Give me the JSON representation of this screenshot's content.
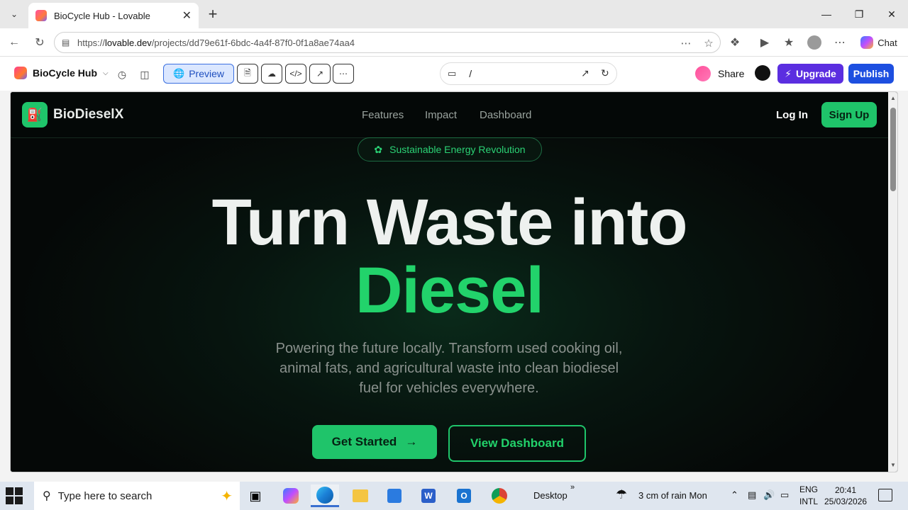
{
  "browser": {
    "tab_title": "BioCycle Hub - Lovable",
    "url_host": "lovable.dev",
    "url_prefix": "https://",
    "url_path": "/projects/dd79e61f-6bdc-4a4f-87f0-0f1a8ae74aa4",
    "chat_label": "Chat"
  },
  "lovable": {
    "project_name": "BioCycle Hub",
    "preview_label": "Preview",
    "route_path": "/",
    "share_label": "Share",
    "upgrade_label": "Upgrade",
    "publish_label": "Publish",
    "colors": {
      "upgrade": "#5b2ee0",
      "publish": "#1d4fe0",
      "preview_bg": "#dbe7ff"
    }
  },
  "site": {
    "brand": "BioDieselX",
    "nav": [
      "Features",
      "Impact",
      "Dashboard"
    ],
    "login_label": "Log In",
    "signup_label": "Sign Up",
    "pill": "Sustainable Energy Revolution",
    "headline_1": "Turn Waste into",
    "headline_2": "Diesel",
    "subtitle": "Powering the future locally. Transform used cooking oil, animal fats, and agricultural waste into clean biodiesel fuel for vehicles everywhere.",
    "cta_primary": "Get Started",
    "cta_secondary": "View Dashboard",
    "colors": {
      "accent": "#22d36b",
      "background": "#050807"
    }
  },
  "taskbar": {
    "search_placeholder": "Type here to search",
    "desktop_label": "Desktop",
    "weather": "3 cm of rain Mon",
    "lang_1": "ENG",
    "lang_2": "INTL",
    "time": "20:41",
    "date": "25/03/2026"
  }
}
